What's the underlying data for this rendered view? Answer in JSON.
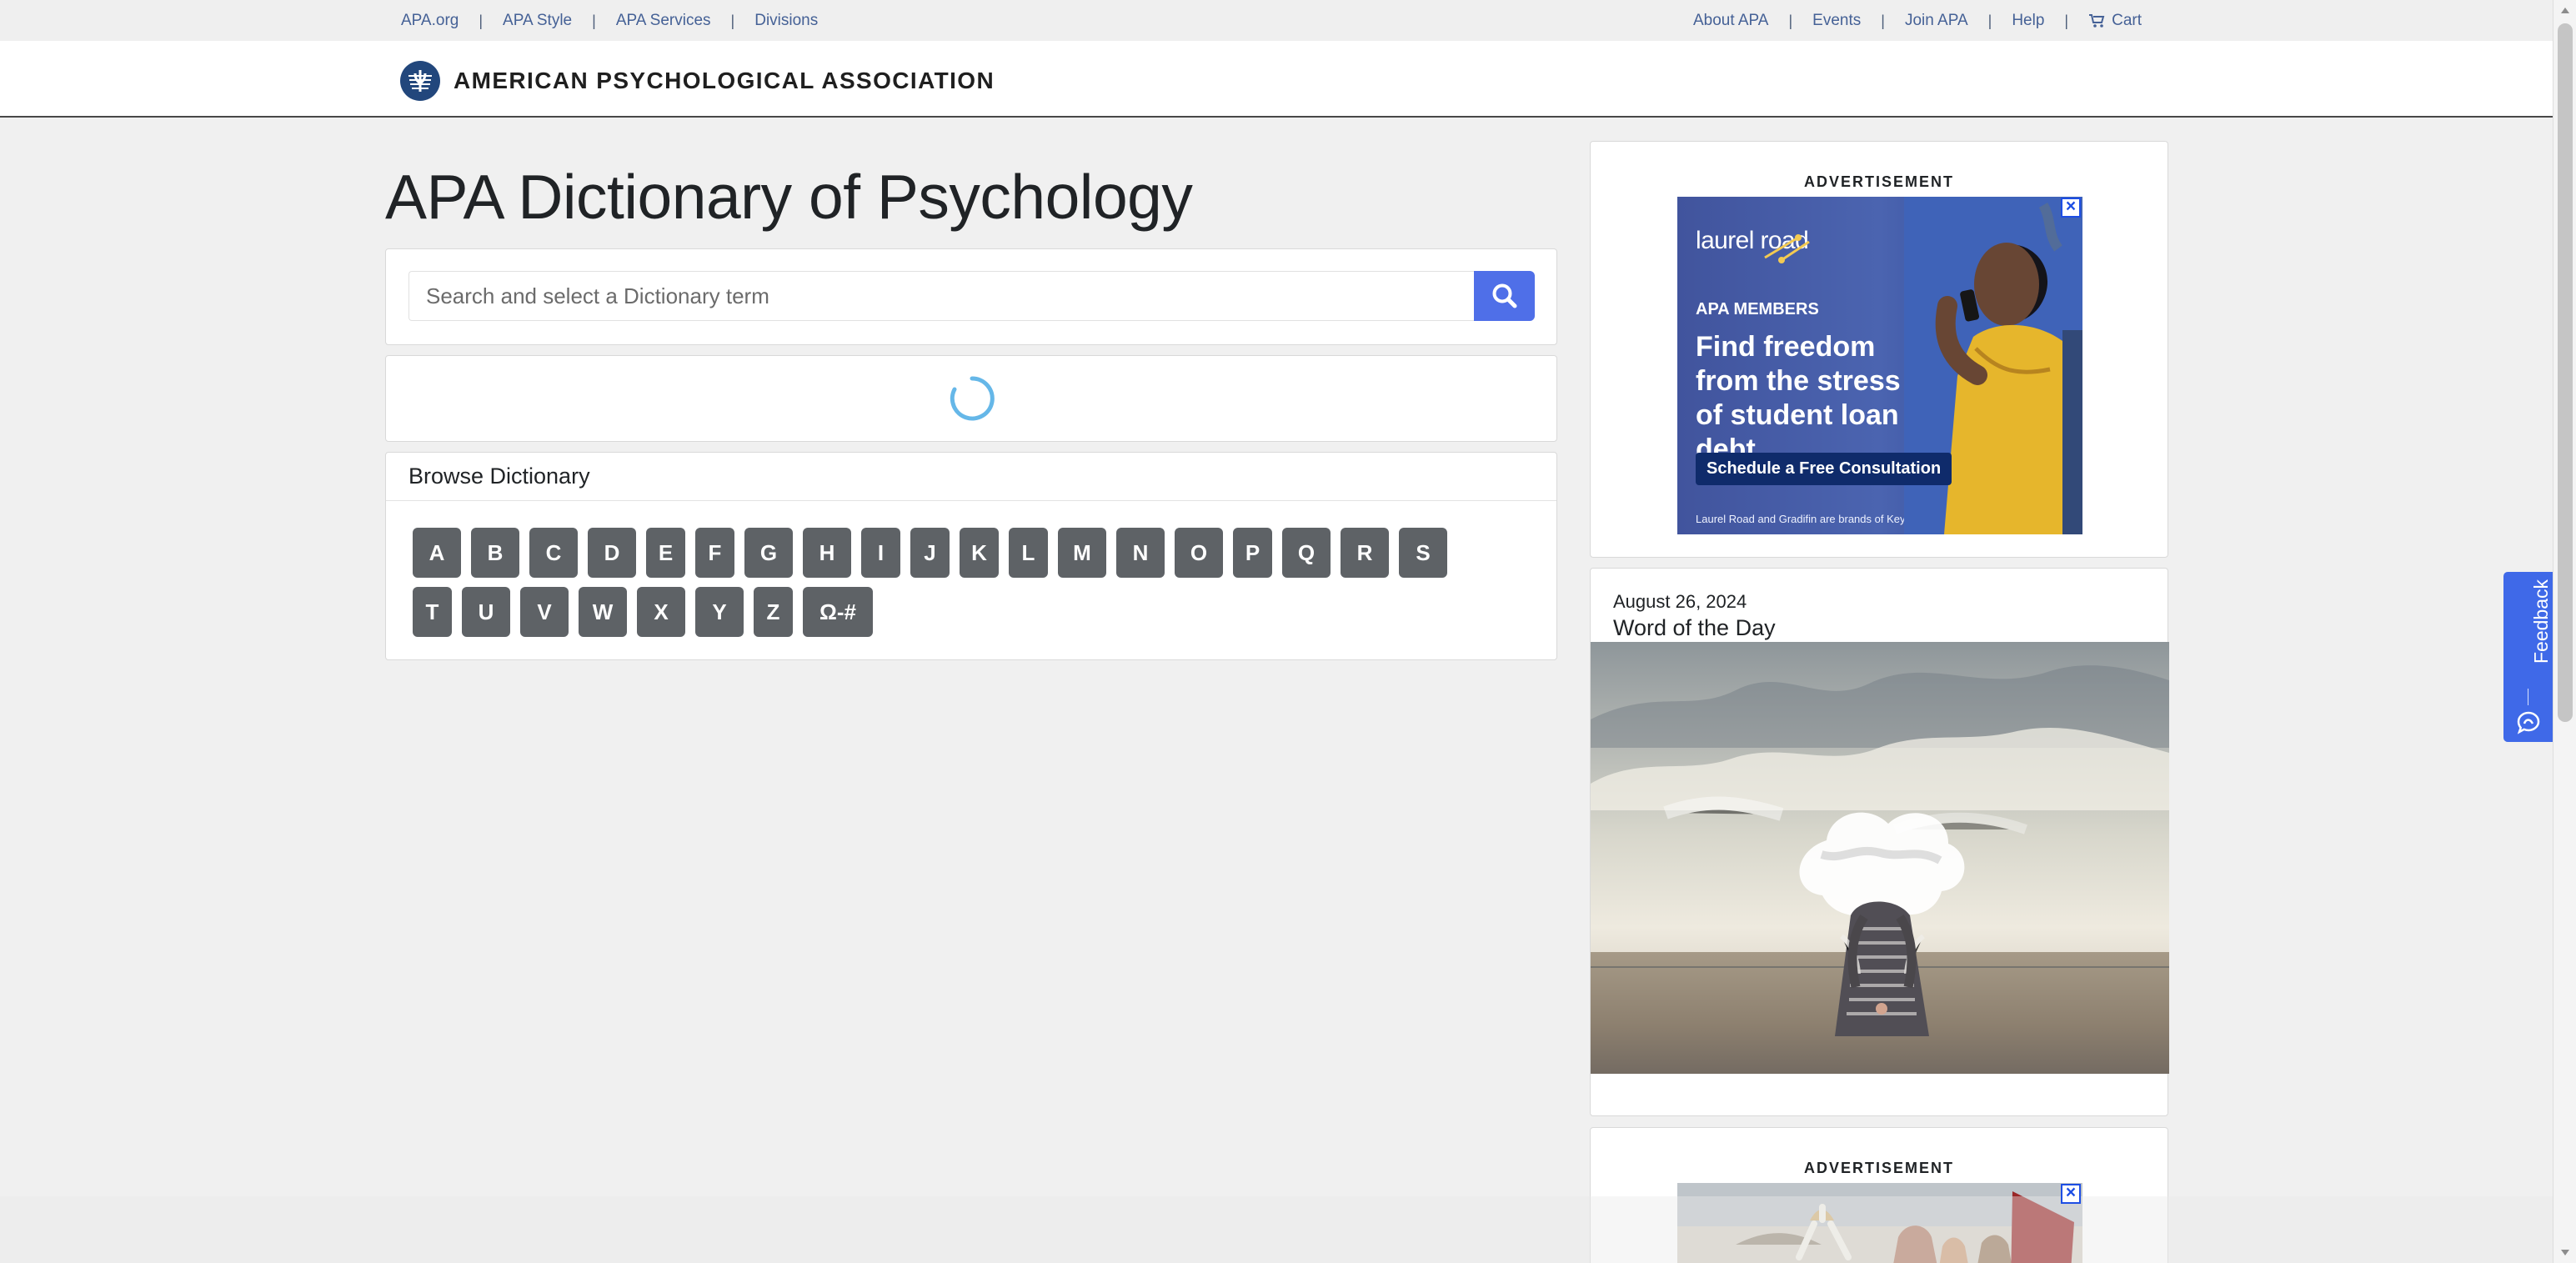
{
  "utility_nav": {
    "left": [
      {
        "label": "APA.org"
      },
      {
        "label": "APA Style"
      },
      {
        "label": "APA Services"
      },
      {
        "label": "Divisions"
      }
    ],
    "right": [
      {
        "label": "About APA"
      },
      {
        "label": "Events"
      },
      {
        "label": "Join APA"
      },
      {
        "label": "Help"
      },
      {
        "label": "Cart",
        "icon": "cart-icon"
      }
    ],
    "separator": "|"
  },
  "header": {
    "brand_name": "AMERICAN PSYCHOLOGICAL ASSOCIATION",
    "logo_icon": "apa-logo-icon"
  },
  "main": {
    "title": "APA Dictionary of Psychology",
    "search": {
      "placeholder": "Search and select a Dictionary term",
      "button_icon": "search-icon"
    },
    "loading_indicator": "loading-spinner-icon",
    "browse": {
      "title": "Browse Dictionary",
      "letters_row1": [
        "A",
        "B",
        "C",
        "D",
        "E",
        "F",
        "G",
        "H",
        "I",
        "J",
        "K",
        "L",
        "M",
        "N",
        "O",
        "P",
        "Q",
        "R",
        "S"
      ],
      "letters_row2": [
        "T",
        "U",
        "V",
        "W",
        "X",
        "Y",
        "Z",
        "Ω-#"
      ]
    }
  },
  "sidebar": {
    "ad_top": {
      "label": "ADVERTISEMENT",
      "brand": "laurel road",
      "badge": "APA MEMBERS",
      "headline": "Find freedom from the stress of student loan debt.",
      "cta": "Schedule a Free Consultation",
      "footnote": "Laurel Road and Gradifin are brands of KeyBank N.A.",
      "close_icon": "close-icon"
    },
    "word_of_day": {
      "date": "August 26, 2024",
      "title": "Word of the Day",
      "image_icon": "cloud-head-woman-image"
    },
    "ad_bottom": {
      "label": "ADVERTISEMENT",
      "close_icon": "close-icon"
    }
  },
  "feedback": {
    "label": "Feedback",
    "icon": "feedback-icon"
  },
  "colors": {
    "accent": "#4f6fe8",
    "letter_button": "#5e6266",
    "link": "#456196",
    "header_border": "#484848"
  }
}
